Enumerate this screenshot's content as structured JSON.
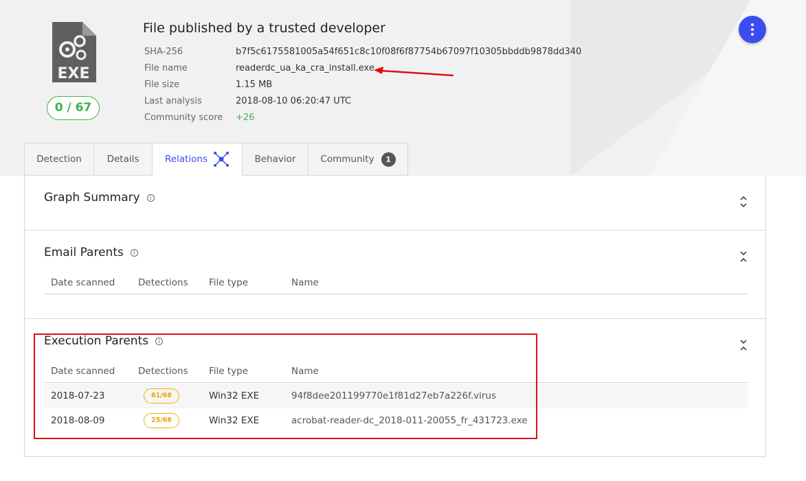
{
  "header": {
    "title": "File published by a trusted developer",
    "score": "0 / 67",
    "file_type_label": "EXE",
    "meta": [
      {
        "key": "SHA-256",
        "value": "b7f5c6175581005a54f651c8c10f08f6f87754b67097f10305bbddb9878dd340"
      },
      {
        "key": "File name",
        "value": "readerdc_ua_ka_cra_install.exe"
      },
      {
        "key": "File size",
        "value": "1.15 MB"
      },
      {
        "key": "Last analysis",
        "value": "2018-08-10 06:20:47 UTC"
      },
      {
        "key": "Community score",
        "value": "+26"
      }
    ]
  },
  "tabs": [
    {
      "label": "Detection"
    },
    {
      "label": "Details"
    },
    {
      "label": "Relations",
      "active": true
    },
    {
      "label": "Behavior"
    },
    {
      "label": "Community",
      "badge": "1"
    }
  ],
  "sections": {
    "graph_summary": {
      "title": "Graph Summary"
    },
    "email_parents": {
      "title": "Email Parents",
      "columns": [
        "Date scanned",
        "Detections",
        "File type",
        "Name"
      ]
    },
    "execution_parents": {
      "title": "Execution Parents",
      "columns": [
        "Date scanned",
        "Detections",
        "File type",
        "Name"
      ],
      "rows": [
        {
          "date": "2018-07-23",
          "detections": "61/68",
          "type": "Win32 EXE",
          "name": "94f8dee201199770e1f81d27eb7a226f.virus"
        },
        {
          "date": "2018-08-09",
          "detections": "25/66",
          "type": "Win32 EXE",
          "name": "acrobat-reader-dc_2018-011-20055_fr_431723.exe"
        }
      ]
    }
  },
  "colors": {
    "accent": "#3b4cf0",
    "clean": "#3db34a",
    "warning": "#f0b400",
    "annotation": "#e01010"
  }
}
